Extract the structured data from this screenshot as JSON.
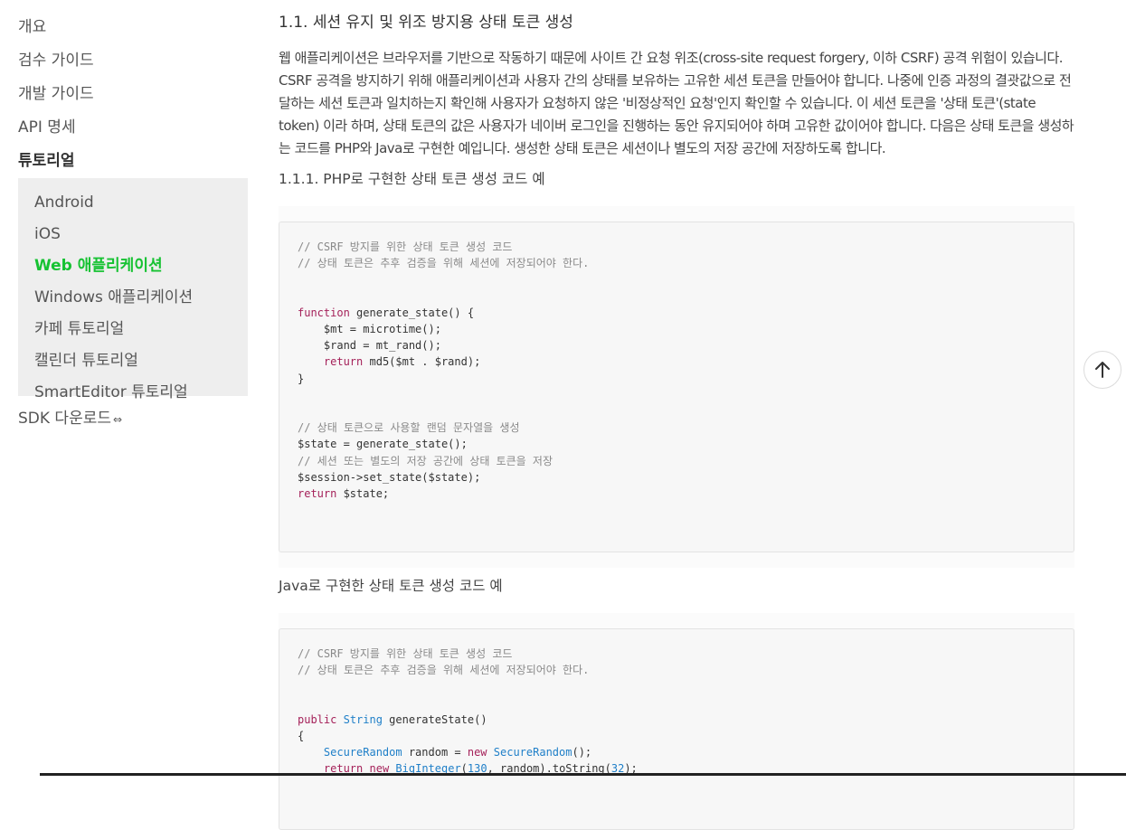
{
  "sidebar": {
    "items": [
      "개요",
      "검수 가이드",
      "개발 가이드",
      "API 명세",
      "튜토리얼"
    ],
    "subitems": [
      "Android",
      "iOS",
      "Web 애플리케이션",
      "Windows 애플리케이션",
      "카페 튜토리얼",
      "캘린더 튜토리얼",
      "SmartEditor 튜토리얼"
    ],
    "sdk_label": "SDK 다운로드",
    "sdk_icon": "⇔"
  },
  "main": {
    "section_title": "1.1. 세션 유지 및 위조 방지용 상태 토큰 생성",
    "description": "웹 애플리케이션은 브라우저를 기반으로 작동하기 때문에 사이트 간 요청 위조(cross-site request forgery, 이하 CSRF) 공격 위험이 있습니다. CSRF 공격을 방지하기 위해 애플리케이션과 사용자 간의 상태를 보유하는 고유한 세션 토큰을 만들어야 합니다. 나중에 인증 과정의 결괏값으로 전달하는 세션 토큰과 일치하는지 확인해 사용자가 요청하지 않은 '비정상적인 요청'인지 확인할 수 있습니다. 이 세션 토큰을 '상태 토큰'(state token) 이라 하며, 상태 토큰의 값은 사용자가 네이버 로그인을 진행하는 동안 유지되어야 하며 고유한 값이어야 합니다. 다음은 상태 토큰을 생성하는 코드를 PHP와 Java로 구현한 예입니다. 생성한 상태 토큰은 세션이나 별도의 저장 공간에 저장하도록 합니다.",
    "php_title": "1.1.1. PHP로 구현한 상태 토큰 생성 코드 예",
    "java_title": "Java로 구현한 상태 토큰 생성 코드 예",
    "php_code": [
      {
        "t": "// CSRF 방지를 위한 상태 토큰 생성 코드",
        "c": "comment"
      },
      {
        "t": "// 상태 토큰은 추후 검증을 위해 세션에 저장되어야 한다.",
        "c": "comment"
      },
      {
        "t": "",
        "c": ""
      },
      {
        "t": "",
        "c": ""
      },
      {
        "t": "function generate_state() {",
        "c": "kwline"
      },
      {
        "t": "    $mt = microtime();",
        "c": ""
      },
      {
        "t": "    $rand = mt_rand();",
        "c": ""
      },
      {
        "t": "    return md5($mt . $rand);",
        "c": "return"
      },
      {
        "t": "}",
        "c": ""
      },
      {
        "t": "",
        "c": ""
      },
      {
        "t": "",
        "c": ""
      },
      {
        "t": "// 상태 토큰으로 사용할 랜덤 문자열을 생성",
        "c": "comment"
      },
      {
        "t": "$state = generate_state();",
        "c": ""
      },
      {
        "t": "// 세션 또는 별도의 저장 공간에 상태 토큰을 저장",
        "c": "comment"
      },
      {
        "t": "$session->set_state($state);",
        "c": ""
      },
      {
        "t": "return $state;",
        "c": "return"
      }
    ],
    "java_code": [
      {
        "t": "// CSRF 방지를 위한 상태 토큰 생성 코드",
        "c": "comment"
      },
      {
        "t": "// 상태 토큰은 추후 검증을 위해 세션에 저장되어야 한다.",
        "c": "comment"
      },
      {
        "t": "",
        "c": ""
      },
      {
        "t": "",
        "c": ""
      },
      {
        "t": "public String generateState()",
        "c": "java1"
      },
      {
        "t": "{",
        "c": ""
      },
      {
        "t": "    SecureRandom random = new SecureRandom();",
        "c": "java2"
      },
      {
        "t": "    return new BigInteger(130, random).toString(32);",
        "c": "java3"
      }
    ]
  },
  "scroll_top_icon": "arrow-up-icon",
  "colors": {
    "active_link": "#16c232",
    "keyword": "#a5225a",
    "type": "#1f7fc8",
    "comment": "#8a8a8a"
  }
}
